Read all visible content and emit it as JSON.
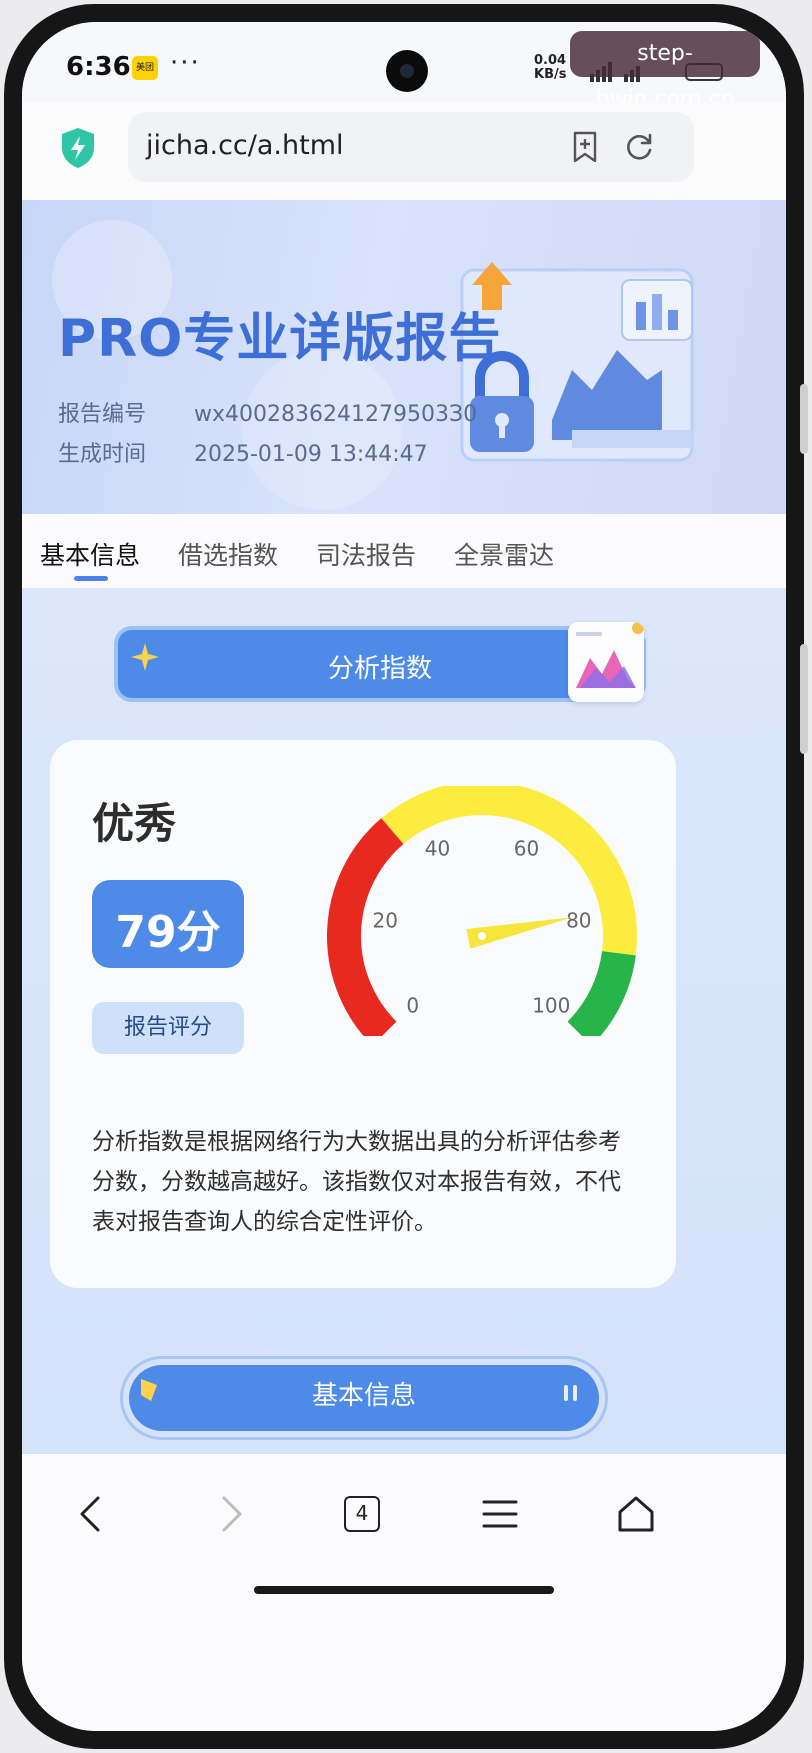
{
  "status_bar": {
    "time": "6:36",
    "app_badge": "美团",
    "overflow": "···",
    "net_speed_value": "0.04",
    "net_speed_unit": "KB/s"
  },
  "watermark": "step-bwin.com.cn",
  "browser": {
    "url": "jicha.cc/a.html",
    "tab_count": "4"
  },
  "banner": {
    "title": "PRO专业详版报告",
    "report_id_label": "报告编号",
    "report_id_value": "wx4002836241279503З0",
    "generated_label": "生成时间",
    "generated_value": "2025-01-09 13:44:47"
  },
  "tabs": [
    {
      "label": "基本信息",
      "active": true
    },
    {
      "label": "借选指数",
      "active": false
    },
    {
      "label": "司法报告",
      "active": false
    },
    {
      "label": "全景雷达",
      "active": false
    }
  ],
  "section": {
    "title": "分析指数"
  },
  "score_card": {
    "rating": "优秀",
    "score": "79分",
    "score_value": 79,
    "score_label": "报告评分",
    "gauge_ticks": [
      "0",
      "20",
      "40",
      "60",
      "80",
      "100"
    ],
    "gauge_colors": {
      "low": "#e8291f",
      "mid": "#fcec3f",
      "high": "#27b54a",
      "needle": "#f6e63c"
    },
    "description": "分析指数是根据网络行为大数据出具的分析评估参考分数，分数越高越好。该指数仅对本报告有效，不代表对报告查询人的综合定性评价。"
  },
  "next_section": {
    "title": "基本信息"
  },
  "icons": [
    "shield-bolt-icon",
    "bookmark-add-icon",
    "reload-icon",
    "back-icon",
    "forward-icon",
    "tabs-icon",
    "menu-icon",
    "home-icon"
  ],
  "colors": {
    "accent": "#4e8be9",
    "banner_title": "#3d6fd6",
    "content_bg": "#dce7fb"
  }
}
